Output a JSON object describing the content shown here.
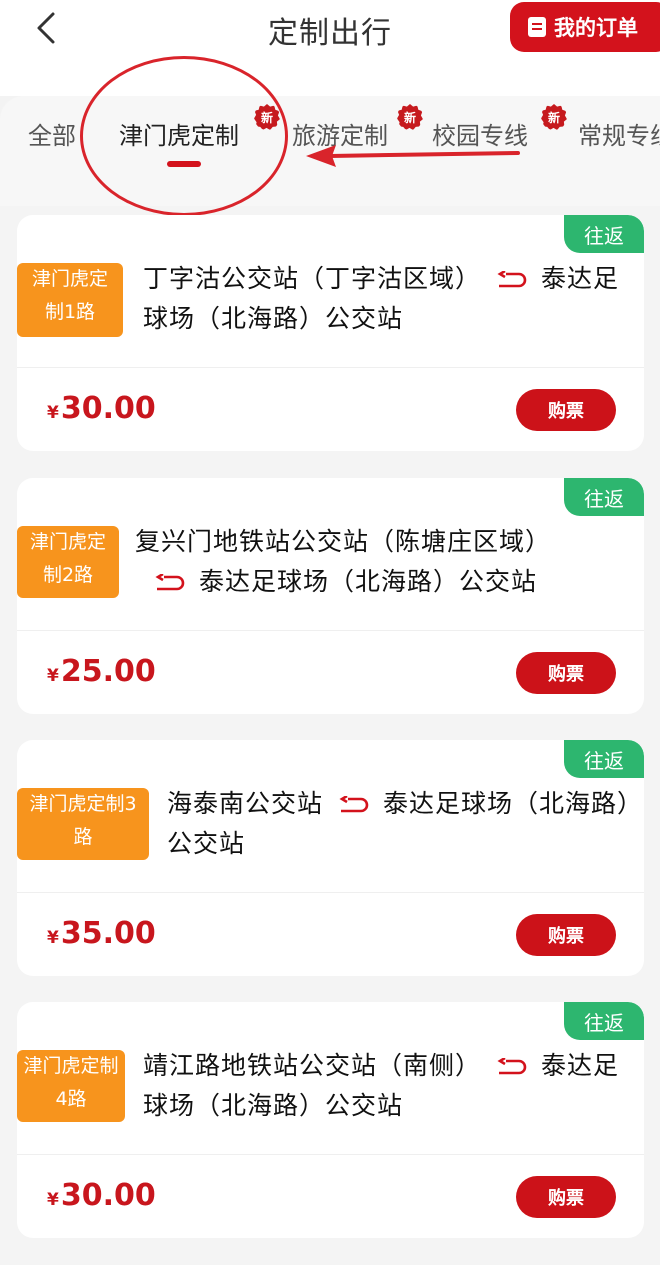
{
  "header": {
    "title": "定制出行",
    "back_icon": "chevron-left-icon",
    "orders_label": "我的订单"
  },
  "tabs": [
    {
      "label": "全部",
      "new": false
    },
    {
      "label": "津门虎定制",
      "new": true,
      "active": true
    },
    {
      "label": "旅游定制",
      "new": true
    },
    {
      "label": "校园专线",
      "new": true
    },
    {
      "label": "常规专线",
      "new": false
    }
  ],
  "new_badge_text": "新",
  "colors": {
    "brand_red": "#d3121c",
    "badge_orange": "#f7941d",
    "trip_green": "#2db66f"
  },
  "routes": [
    {
      "badge": "津门虎定制1路",
      "trip_type": "往返",
      "from": "丁字沽公交站（丁字沽区域）",
      "to": "泰达足球场（北海路）公交站",
      "currency": "¥",
      "price": "30.00",
      "buy_label": "购票"
    },
    {
      "badge": "津门虎定制2路",
      "trip_type": "往返",
      "from": "复兴门地铁站公交站（陈塘庄区域）",
      "to": "泰达足球场（北海路）公交站",
      "currency": "¥",
      "price": "25.00",
      "buy_label": "购票"
    },
    {
      "badge": "津门虎定制3路",
      "trip_type": "往返",
      "from": "海泰南公交站",
      "to": "泰达足球场（北海路）公交站",
      "currency": "¥",
      "price": "35.00",
      "buy_label": "购票"
    },
    {
      "badge": "津门虎定制4路",
      "trip_type": "往返",
      "from": "靖江路地铁站公交站（南侧）",
      "to": "泰达足球场（北海路）公交站",
      "currency": "¥",
      "price": "30.00",
      "buy_label": "购票"
    }
  ]
}
